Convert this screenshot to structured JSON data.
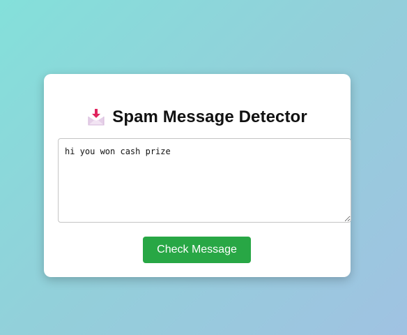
{
  "header": {
    "icon": "inbox-tray-icon",
    "title": "Spam Message Detector"
  },
  "message": {
    "value": "hi you won cash prize",
    "placeholder": ""
  },
  "actions": {
    "check_label": "Check Message"
  },
  "colors": {
    "background_gradient_start": "#84e0da",
    "background_gradient_end": "#a0c2e2",
    "card": "#ffffff",
    "button": "#28a745",
    "button_text": "#ffffff",
    "icon_arrow": "#e0245e",
    "icon_tray": "#e5cfe8"
  }
}
